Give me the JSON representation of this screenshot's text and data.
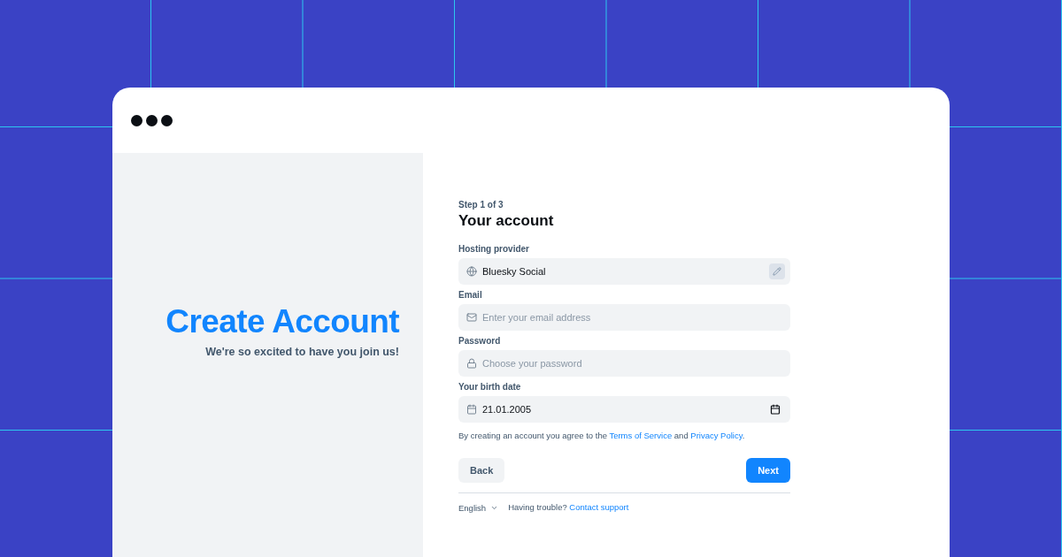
{
  "hero": {
    "title": "Create Account",
    "subtitle": "We're so excited to have you join us!"
  },
  "form": {
    "step": "Step 1 of 3",
    "title": "Your account",
    "fields": [
      {
        "kind": "provider",
        "label": "Hosting provider",
        "value": "Bluesky Social"
      },
      {
        "kind": "email",
        "label": "Email",
        "placeholder": "Enter your email address"
      },
      {
        "kind": "password",
        "label": "Password",
        "placeholder": "Choose your password"
      },
      {
        "kind": "date",
        "label": "Your birth date",
        "value": "21.01.2005"
      }
    ],
    "terms": [
      {
        "kind": "text",
        "text": "By creating an account you agree to the "
      },
      {
        "kind": "link",
        "text": "Terms of Service"
      },
      {
        "kind": "text",
        "text": " and "
      },
      {
        "kind": "link",
        "text": "Privacy Policy"
      },
      {
        "kind": "text",
        "text": "."
      }
    ],
    "buttons": [
      {
        "kind": "secondary",
        "label": "Back"
      },
      {
        "kind": "primary",
        "label": "Next"
      }
    ]
  },
  "footer": {
    "language": "English",
    "help": [
      {
        "kind": "text",
        "text": "Having trouble? "
      },
      {
        "kind": "link",
        "text": "Contact support"
      }
    ]
  }
}
